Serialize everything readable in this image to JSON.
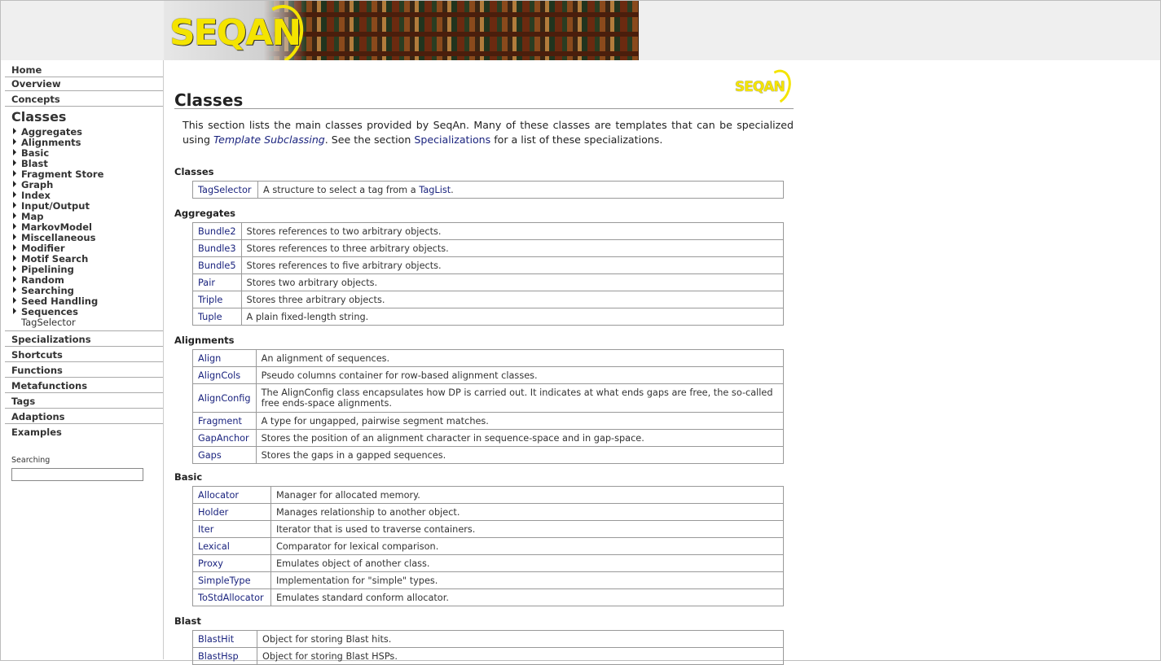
{
  "banner": {
    "logo_text": "SEQAN"
  },
  "sidebar": {
    "top_items": [
      "Home",
      "Overview",
      "Concepts"
    ],
    "classes_label": "Classes",
    "sub_items": [
      "Aggregates",
      "Alignments",
      "Basic",
      "Blast",
      "Fragment Store",
      "Graph",
      "Index",
      "Input/Output",
      "Map",
      "MarkovModel",
      "Miscellaneous",
      "Modifier",
      "Motif Search",
      "Pipelining",
      "Random",
      "Searching",
      "Seed Handling",
      "Sequences"
    ],
    "plain_sub_item": "TagSelector",
    "bottom_items": [
      "Specializations",
      "Shortcuts",
      "Functions",
      "Metafunctions",
      "Tags",
      "Adaptions",
      "Examples"
    ],
    "search_label": "Searching",
    "search_value": ""
  },
  "main": {
    "title": "Classes",
    "corner_logo": "SEQAN",
    "intro": {
      "part1": "This section lists the main classes provided by SeqAn. Many of these classes are templates that can be specialized using ",
      "link1": "Template Subclassing",
      "part2": ". See the section ",
      "link2": "Specializations",
      "part3": " for a list of these specializations."
    },
    "sections": [
      {
        "title": "Classes",
        "rows": [
          {
            "name": "TagSelector",
            "desc": "A structure to select a tag from a ",
            "desc_link": "TagList",
            "desc_after": "."
          }
        ]
      },
      {
        "title": "Aggregates",
        "rows": [
          {
            "name": "Bundle2",
            "desc": "Stores references to two arbitrary objects."
          },
          {
            "name": "Bundle3",
            "desc": "Stores references to three arbitrary objects."
          },
          {
            "name": "Bundle5",
            "desc": "Stores references to five arbitrary objects."
          },
          {
            "name": "Pair",
            "desc": "Stores two arbitrary objects."
          },
          {
            "name": "Triple",
            "desc": "Stores three arbitrary objects."
          },
          {
            "name": "Tuple",
            "desc": "A plain fixed-length string."
          }
        ]
      },
      {
        "title": "Alignments",
        "rows": [
          {
            "name": "Align",
            "desc": "An alignment of sequences."
          },
          {
            "name": "AlignCols",
            "desc": "Pseudo columns container for row-based alignment classes."
          },
          {
            "name": "AlignConfig",
            "desc": "The AlignConfig class encapsulates how DP is carried out. It indicates at what ends gaps are free, the so-called free ends-space alignments.",
            "tall": true
          },
          {
            "name": "Fragment",
            "desc": "A type for ungapped, pairwise segment matches."
          },
          {
            "name": "GapAnchor",
            "desc": "Stores the position of an alignment character in sequence-space and in gap-space."
          },
          {
            "name": "Gaps",
            "desc": "Stores the gaps in a gapped sequences."
          }
        ]
      },
      {
        "title": "Basic",
        "rows": [
          {
            "name": "Allocator",
            "desc": "Manager for allocated memory."
          },
          {
            "name": "Holder",
            "desc": "Manages relationship to another object."
          },
          {
            "name": "Iter",
            "desc": "Iterator that is used to traverse containers."
          },
          {
            "name": "Lexical",
            "desc": "Comparator for lexical comparison."
          },
          {
            "name": "Proxy",
            "desc": "Emulates object of another class."
          },
          {
            "name": "SimpleType",
            "desc": "Implementation for \"simple\" types."
          },
          {
            "name": "ToStdAllocator",
            "desc": "Emulates standard conform allocator."
          }
        ]
      },
      {
        "title": "Blast",
        "rows": [
          {
            "name": "BlastHit",
            "desc": "Object for storing Blast hits."
          },
          {
            "name": "BlastHsp",
            "desc": "Object for storing Blast HSPs."
          }
        ]
      }
    ]
  }
}
